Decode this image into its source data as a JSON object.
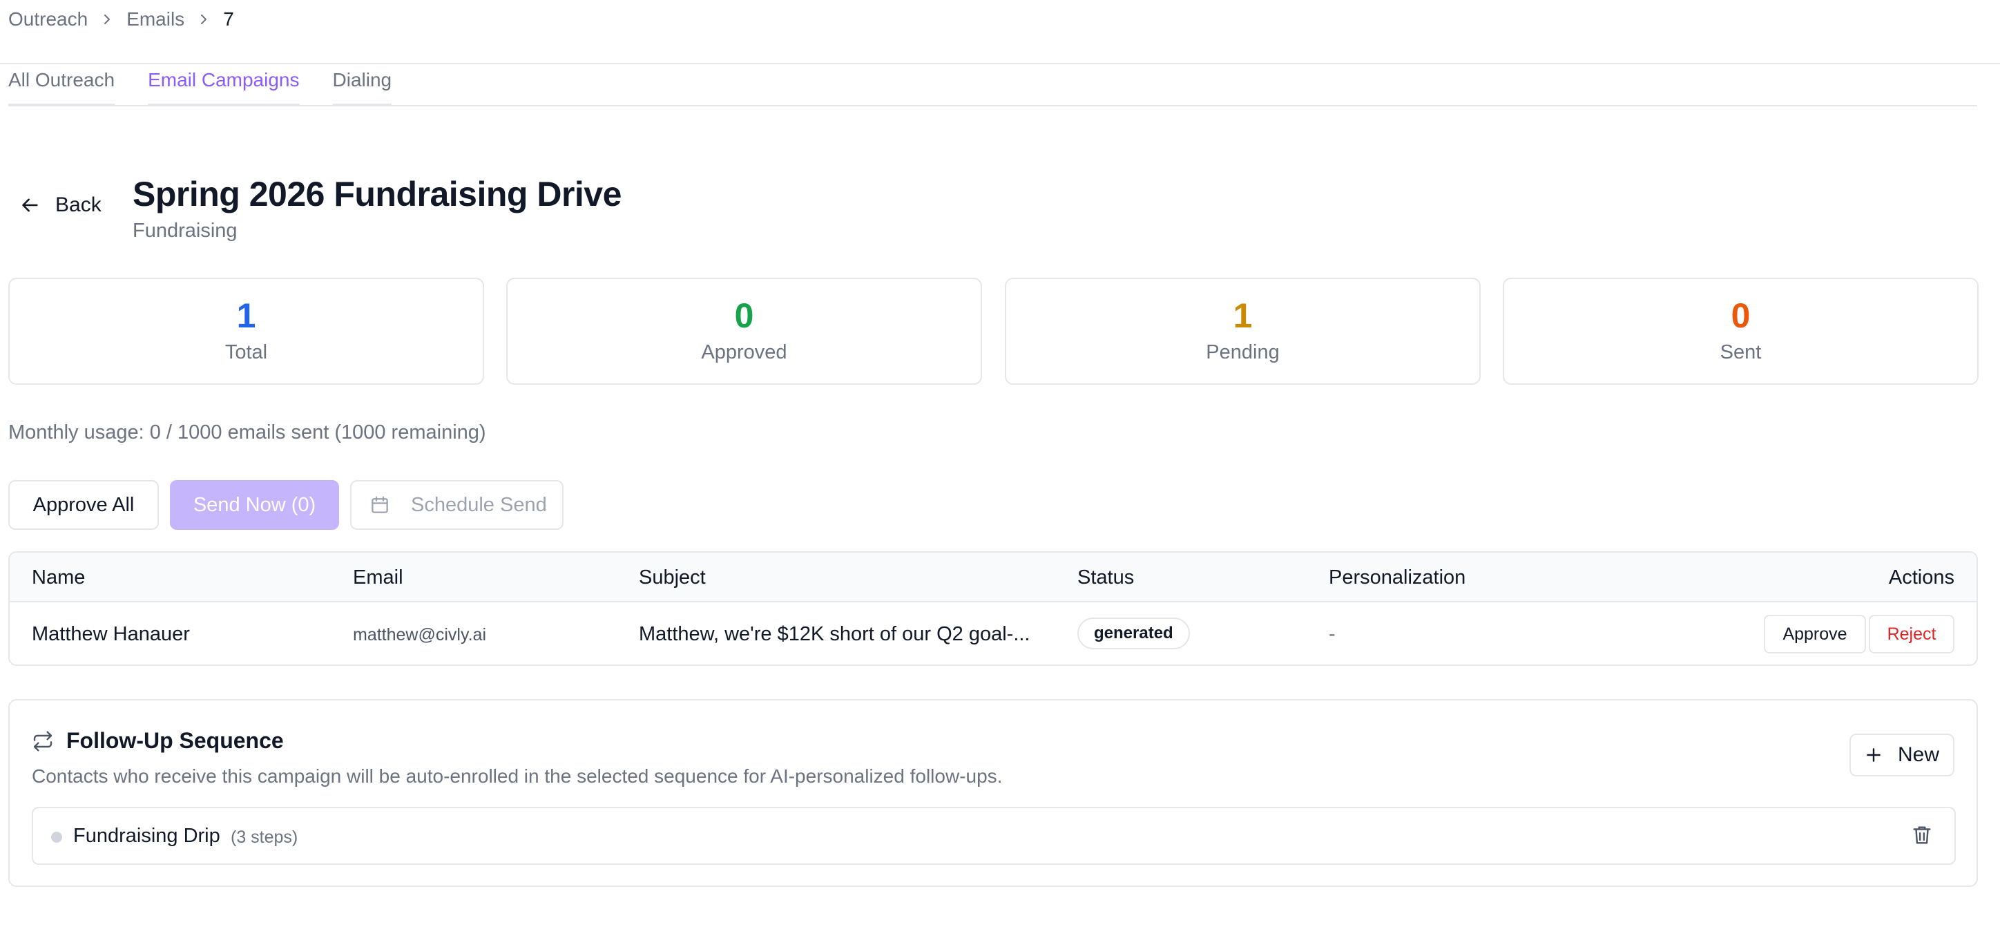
{
  "breadcrumb": {
    "items": [
      "Outreach",
      "Emails"
    ],
    "current": "7"
  },
  "tabs": [
    {
      "label": "All Outreach",
      "active": false
    },
    {
      "label": "Email Campaigns",
      "active": true
    },
    {
      "label": "Dialing",
      "active": false
    }
  ],
  "back_label": "Back",
  "campaign": {
    "title": "Spring 2026 Fundraising Drive",
    "category": "Fundraising"
  },
  "stats": [
    {
      "value": "1",
      "label": "Total",
      "color": "#2563eb"
    },
    {
      "value": "0",
      "label": "Approved",
      "color": "#16a34a"
    },
    {
      "value": "1",
      "label": "Pending",
      "color": "#ca8a04"
    },
    {
      "value": "0",
      "label": "Sent",
      "color": "#ea580c"
    }
  ],
  "usage": "Monthly usage: 0 / 1000 emails sent (1000 remaining)",
  "toolbar": {
    "approve_all": "Approve All",
    "send_now": "Send Now (0)",
    "schedule_send": "Schedule Send"
  },
  "table": {
    "headers": {
      "name": "Name",
      "email": "Email",
      "subject": "Subject",
      "status": "Status",
      "personalization": "Personalization",
      "actions": "Actions"
    },
    "rows": [
      {
        "name": "Matthew Hanauer",
        "email": "matthew@civly.ai",
        "subject": "Matthew, we're $12K short of our Q2 goal-...",
        "status": "generated",
        "personalization": "-",
        "approve_label": "Approve",
        "reject_label": "Reject"
      }
    ]
  },
  "sequence": {
    "title": "Follow-Up Sequence",
    "description": "Contacts who receive this campaign will be auto-enrolled in the selected sequence for AI-personalized follow-ups.",
    "new_label": "New",
    "items": [
      {
        "name": "Fundraising Drip",
        "steps": "(3 steps)"
      }
    ]
  },
  "colors": {
    "accent": "#8b5cf6",
    "accent_disabled": "#c4b5fd",
    "danger": "#dc2626",
    "border": "#e5e7eb"
  },
  "icons": [
    "chevron-right-icon",
    "arrow-left-icon",
    "calendar-icon",
    "repeat-icon",
    "plus-icon",
    "trash-icon"
  ]
}
